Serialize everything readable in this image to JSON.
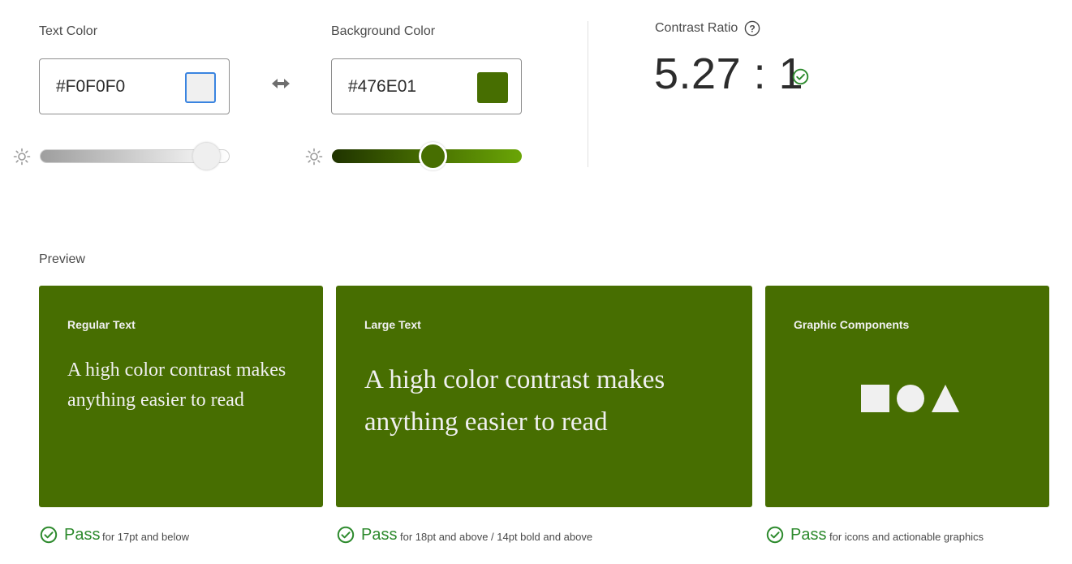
{
  "colors": {
    "text_hex": "#F0F0F0",
    "background_hex": "#476E01",
    "accent": "#3a84e0",
    "pass_green": "#2d8a2d"
  },
  "text_color": {
    "label": "Text Color",
    "value": "#F0F0F0",
    "brightness": 0.88
  },
  "background_color": {
    "label": "Background Color",
    "value": "#476E01",
    "brightness": 0.53
  },
  "icons": {
    "swap": "left-right-arrow-icon",
    "brightness": "sun-icon",
    "help": "question-circle-icon",
    "check": "check-circle-icon"
  },
  "contrast": {
    "label": "Contrast Ratio",
    "value": "5.27 : 1"
  },
  "preview": {
    "label": "Preview",
    "regular": {
      "title": "Regular Text",
      "sample": "A high color contrast makes anything easier to read",
      "result": "Pass",
      "criteria": "for 17pt and below"
    },
    "large": {
      "title": "Large Text",
      "sample": "A high color contrast makes anything easier to read",
      "result": "Pass",
      "criteria": "for 18pt and above / 14pt bold and above"
    },
    "graphic": {
      "title": "Graphic Components",
      "shapes": [
        "square",
        "circle",
        "triangle"
      ],
      "result": "Pass",
      "criteria": "for icons and actionable graphics"
    }
  }
}
